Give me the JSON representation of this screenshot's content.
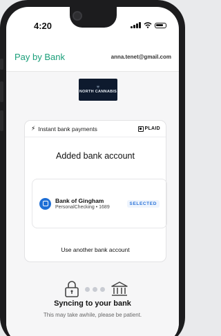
{
  "status_bar": {
    "time": "4:20"
  },
  "header": {
    "title": "Pay by Bank",
    "email": "anna.tenet@gmail.com"
  },
  "merchant": {
    "logo_text": "NORTH CANNABIS",
    "logo_icon": "leaf-icon"
  },
  "card": {
    "header_label": "Instant bank payments",
    "header_icon": "bolt-icon",
    "provider": "PLAID",
    "title": "Added bank account",
    "bank": {
      "name": "Bank of Gingham",
      "account": "PersonalChecking • 1689",
      "badge": "SELECTED",
      "icon": "bank-icon"
    },
    "another_bank_label": "Use another bank account"
  },
  "sync": {
    "title": "Syncing to your bank",
    "subtitle": "This may take awhile, please be patient.",
    "left_icon": "lock-icon",
    "right_icon": "bank-building-icon"
  },
  "colors": {
    "brand": "#1a9f7a",
    "selected": "#2a73d9",
    "bank_icon": "#1f6fd6"
  }
}
